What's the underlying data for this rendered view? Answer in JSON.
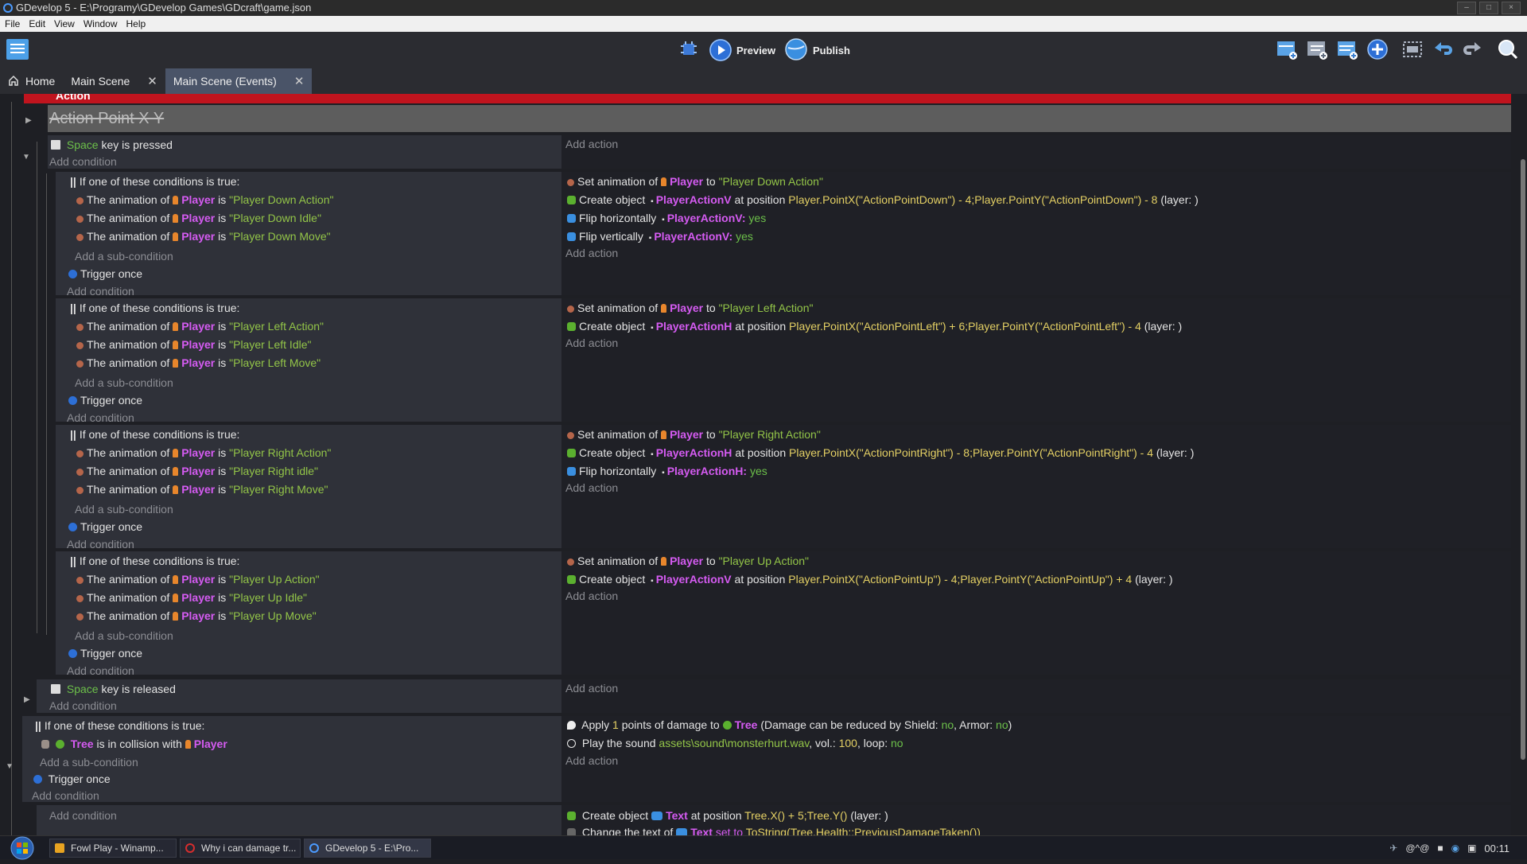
{
  "window": {
    "title": "GDevelop 5 - E:\\Programy\\GDevelop Games\\GDcraft\\game.json"
  },
  "menu": [
    "File",
    "Edit",
    "View",
    "Window",
    "Help"
  ],
  "toolbar": {
    "preview_label": "Preview",
    "publish_label": "Publish"
  },
  "tabs": [
    {
      "label": "Home",
      "closable": false
    },
    {
      "label": "Main Scene",
      "closable": true
    },
    {
      "label": "Main Scene (Events)",
      "closable": true,
      "active": true
    }
  ],
  "events": {
    "red_bar_label": "Action",
    "comment": "Action Point X Y",
    "add_action": "Add action",
    "add_condition": "Add condition",
    "add_subcondition": "Add a sub-condition",
    "or_label": "If one of these conditions is true:",
    "trigger_once": "Trigger once",
    "key_pressed": {
      "key": "Space",
      "rest": "key is pressed"
    },
    "key_released": {
      "key": "Space",
      "rest": "key is released"
    },
    "cond_prefix": "The animation of",
    "player": "Player",
    "is": "is",
    "set_anim": "Set animation of",
    "to": "to",
    "create_object": "Create object",
    "at_position": "at position",
    "layer": "(layer: )",
    "flip_h": "Flip horizontally",
    "flip_v": "Flip vertically",
    "yes": "yes",
    "groups": [
      {
        "conditions": [
          "\"Player Down Action\"",
          "\"Player Down Idle\"",
          "\"Player Down Move\""
        ],
        "set_to": "\"Player Down Action\"",
        "create_obj": "PlayerActionV",
        "position": "Player.PointX(\"ActionPointDown\") - 4;Player.PointY(\"ActionPointDown\") - 8",
        "flip_h_obj": "PlayerActionV:",
        "flip_v_obj": "PlayerActionV:"
      },
      {
        "conditions": [
          "\"Player Left Action\"",
          "\"Player Left Idle\"",
          "\"Player Left Move\""
        ],
        "set_to": "\"Player Left Action\"",
        "create_obj": "PlayerActionH",
        "position": "Player.PointX(\"ActionPointLeft\") + 6;Player.PointY(\"ActionPointLeft\") - 4"
      },
      {
        "conditions": [
          "\"Player Right Action\"",
          "\"Player Right idle\"",
          "\"Player Right Move\""
        ],
        "set_to": "\"Player Right Action\"",
        "create_obj": "PlayerActionH",
        "position": "Player.PointX(\"ActionPointRight\") - 8;Player.PointY(\"ActionPointRight\") - 4",
        "flip_h_obj": "PlayerActionH:"
      },
      {
        "conditions": [
          "\"Player Up Action\"",
          "\"Player Up Idle\"",
          "\"Player Up Move\""
        ],
        "set_to": "\"Player Up Action\"",
        "create_obj": "PlayerActionV",
        "position": "Player.PointX(\"ActionPointUp\") - 4;Player.PointY(\"ActionPointUp\") + 4"
      }
    ],
    "collision": {
      "tree": "Tree",
      "text": "is in collision with",
      "apply": "Apply",
      "damage_num": "1",
      "damage_text": "points of damage to",
      "damage_tail_a": "(Damage can be reduced by Shield:",
      "no": "no",
      "damage_tail_b": ", Armor:",
      "close": ")",
      "play_sound": "Play the sound",
      "sound_file": "assets\\sound\\monsterhurt.wav",
      "vol_label": ", vol.:",
      "vol": "100",
      "loop_label": ", loop:"
    },
    "last": {
      "create_text_obj": "Text",
      "position": "Tree.X() + 5;Tree.Y()",
      "change_text": "Change the text of",
      "set_to": "set to",
      "text_expr": "ToString(Tree.Health::PreviousDamageTaken())"
    }
  },
  "taskbar": {
    "items": [
      "Fowl Play - Winamp...",
      "Why i can damage tr...",
      "GDevelop 5 - E:\\Pro..."
    ],
    "tray_text": "@^@",
    "clock": "00:11"
  },
  "colors": {
    "object": "#d55bf2",
    "string": "#93c548",
    "expression": "#e4d064",
    "keyword": "#6cc04a",
    "accent_red": "#c0141e"
  }
}
